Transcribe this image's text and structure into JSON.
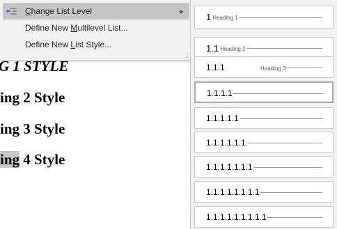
{
  "document": {
    "line1": "G 1 STYLE",
    "line2": "ing 2 Style",
    "line3": "ing 3 Style",
    "line4_prefix": "ing",
    "line4_suffix": " 4 Style"
  },
  "menu": {
    "items": [
      {
        "label": "Change List Level",
        "accel": "C"
      },
      {
        "label": "Define New Multilevel List...",
        "accel": "M"
      },
      {
        "label": "Define New List Style...",
        "accel": "L"
      }
    ]
  },
  "gallery": {
    "levels": [
      {
        "number": "1",
        "heading": "Heading 1"
      },
      {
        "number": "1.1",
        "heading": "Heading 2"
      },
      {
        "number": "1.1.1",
        "heading": "Heading 3"
      },
      {
        "number": "1.1.1.1",
        "heading": ""
      },
      {
        "number": "1.1.1.1.1",
        "heading": ""
      },
      {
        "number": "1.1.1.1.1.1",
        "heading": ""
      },
      {
        "number": "1.1.1.1.1.1.1",
        "heading": ""
      },
      {
        "number": "1.1.1.1.1.1.1.1",
        "heading": ""
      },
      {
        "number": "1.1.1.1.1.1.1.1.1",
        "heading": ""
      }
    ]
  },
  "icons": {
    "change_level": "indent-list-icon",
    "submenu_arrow": "chevron-right-icon",
    "resize_grip": "resize-grip-icon"
  },
  "colors": {
    "menu_bg": "#f2f2f2",
    "highlight": "#c5c5c5",
    "border": "#c6c6c6"
  }
}
